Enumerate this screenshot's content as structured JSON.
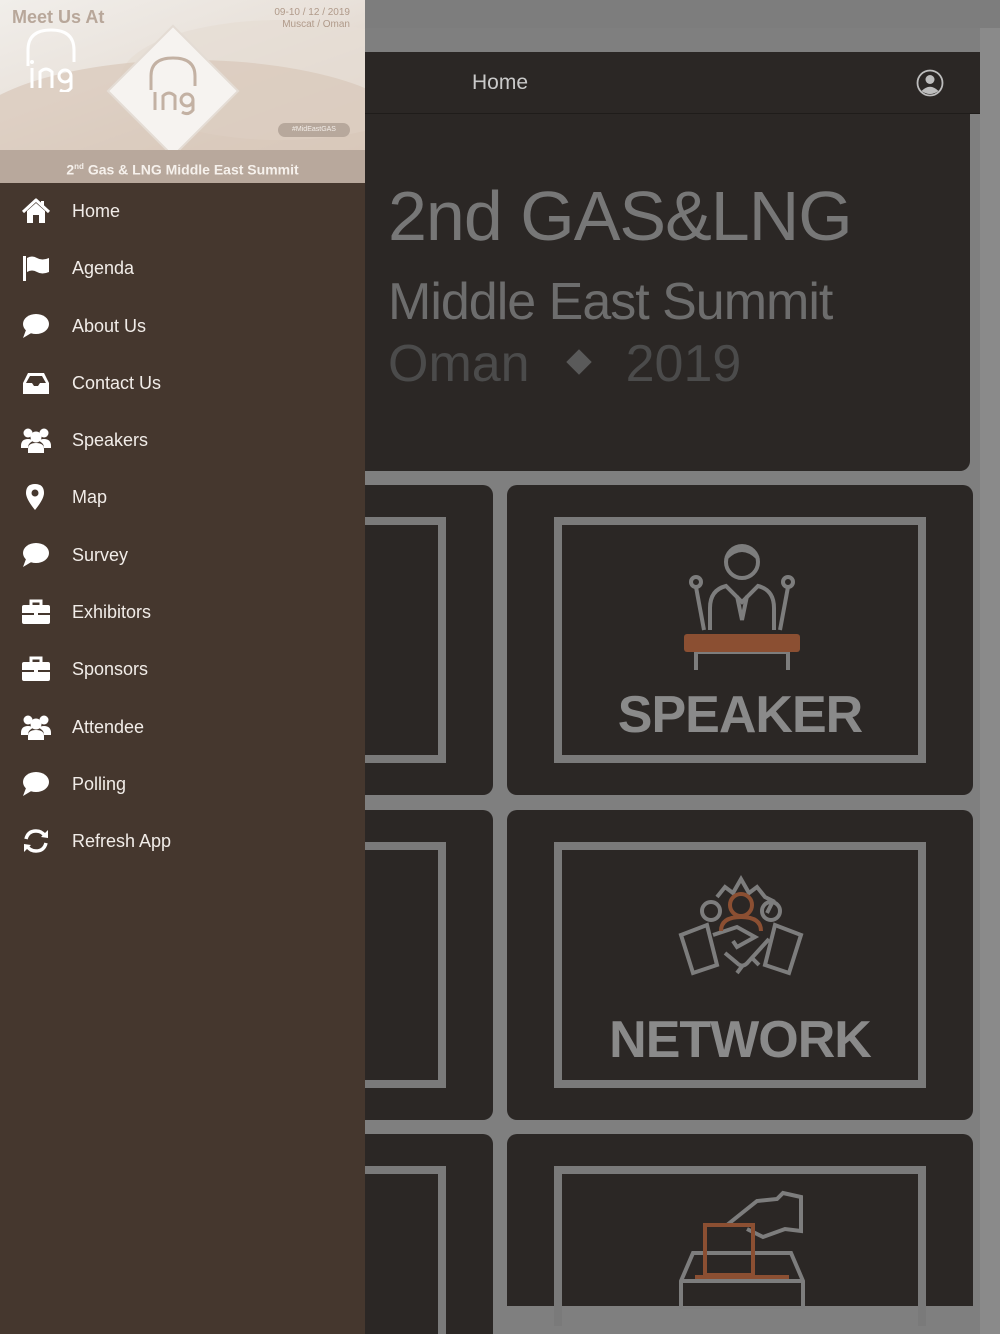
{
  "app": {
    "nav_title": "Home",
    "hero": {
      "line1": "2nd GAS&LNG",
      "line2": "Middle East Summit",
      "line3_left": "Oman",
      "line3_right": "2019"
    },
    "tiles": {
      "speaker": "SPEAKER",
      "network": "NETWORK"
    }
  },
  "drawer": {
    "banner": {
      "meet": "Meet Us At",
      "date_line1": "09-10 / 12 / 2019",
      "date_line2": "Muscat / Oman",
      "hashtag": "#MidEastGAS",
      "summit_prefix": "2",
      "summit_sup": "nd",
      "summit_text": " Gas & LNG Middle East Summit"
    },
    "items": [
      {
        "label": "Home",
        "icon": "home-icon"
      },
      {
        "label": "Agenda",
        "icon": "flag-icon"
      },
      {
        "label": "About Us",
        "icon": "chat-bubble-icon"
      },
      {
        "label": "Contact Us",
        "icon": "inbox-icon"
      },
      {
        "label": "Speakers",
        "icon": "group-icon"
      },
      {
        "label": "Map",
        "icon": "map-pin-icon"
      },
      {
        "label": "Survey",
        "icon": "chat-bubble-icon"
      },
      {
        "label": "Exhibitors",
        "icon": "briefcase-icon"
      },
      {
        "label": "Sponsors",
        "icon": "briefcase-icon"
      },
      {
        "label": "Attendee",
        "icon": "group-icon"
      },
      {
        "label": "Polling",
        "icon": "chat-bubble-icon"
      },
      {
        "label": "Refresh App",
        "icon": "refresh-icon"
      }
    ]
  },
  "colors": {
    "drawer_bg": "#45372e",
    "app_dark": "#2b2725",
    "accent": "#8b4f32"
  }
}
